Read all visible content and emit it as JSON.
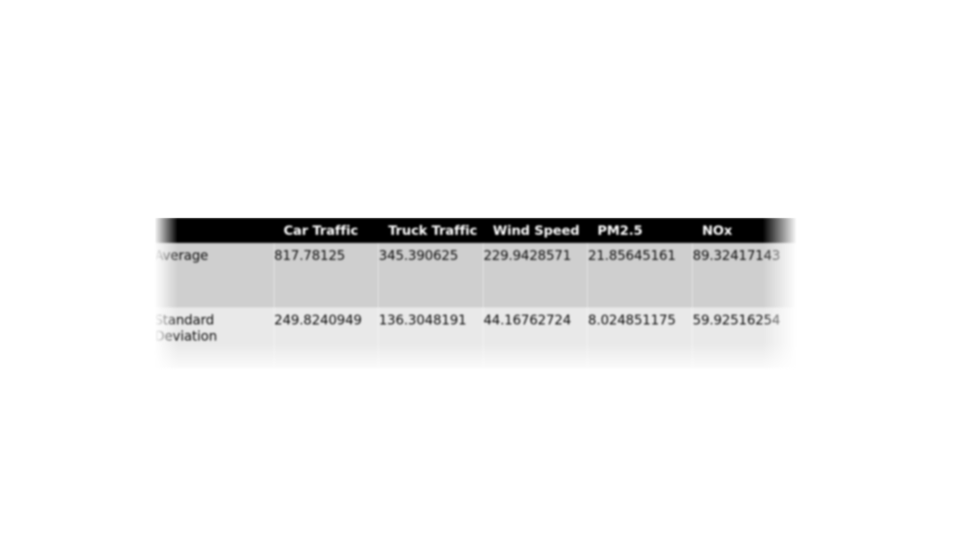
{
  "table": {
    "columns": [
      {
        "key": "label",
        "label": ""
      },
      {
        "key": "car_traffic",
        "label": "Car Traffic"
      },
      {
        "key": "truck_traffic",
        "label": "Truck Traffic"
      },
      {
        "key": "wind_speed",
        "label": "Wind Speed"
      },
      {
        "key": "pm25",
        "label": "PM2.5"
      },
      {
        "key": "nox",
        "label": "NOx"
      }
    ],
    "rows": [
      {
        "label": "Average",
        "values": [
          "817.78125",
          "345.390625",
          "229.9428571",
          "21.85645161",
          "89.32417143"
        ]
      },
      {
        "label": "Standard Deviation",
        "values": [
          "249.8240949",
          "136.3048191",
          "44.16762724",
          "8.024851175",
          "59.92516254"
        ]
      }
    ],
    "style": {
      "header_background": "#000000",
      "header_text_color": "#ffffff",
      "row_even_background": "#cfcfcf",
      "row_odd_background": "#e9e9e9",
      "body_text_color": "#0b0b0b",
      "page_background": "#ffffff"
    }
  }
}
